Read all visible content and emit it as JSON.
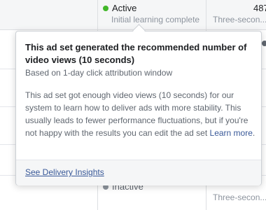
{
  "table": {
    "top_row": {
      "status": "Active",
      "status_sub": "Initial learning complete",
      "number": "487",
      "three_sec": "Three-secon..."
    },
    "bottom_row": {
      "status": "Inactive",
      "three_sec": "Three-secon..."
    }
  },
  "tooltip": {
    "title": "This ad set generated the recommended number of video views (10 seconds)",
    "subtitle": "Based on 1-day click attribution window",
    "body": "This ad set got enough video views (10 seconds) for our system to learn how to deliver ads with more stability. This usually leads to fewer performance fluctuations, but if you're not happy with the results you can edit the ad set",
    "learn_more": "Learn more",
    "body_end": ".",
    "footer_link": "See Delivery Insights"
  },
  "colors": {
    "active": "#42b72a",
    "inactive": "#8d949e",
    "link": "#385898"
  }
}
